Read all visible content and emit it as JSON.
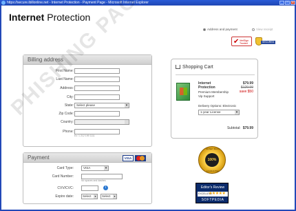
{
  "window": {
    "title": "https://secure.ibillonline.net - Internet Protection - Payment Page - Microsoft Internet Explorer",
    "buttons": [
      "_",
      "□",
      "x"
    ]
  },
  "header": {
    "title_bold": "Internet",
    "title_rest": " Protection"
  },
  "steps": {
    "step1": "Address and payment",
    "step2": "View receipt"
  },
  "trust": {
    "verisign": "VeriSign Trusted",
    "secured": "SECURED"
  },
  "billing": {
    "heading": "Billing address",
    "labels": {
      "first_name": "First Name:",
      "last_name": "Last Name:",
      "address": "Address:",
      "city": "City:",
      "state": "State:",
      "zip": "Zip Code:",
      "country": "Country:",
      "phone": "Phone:"
    },
    "state_value": "Select please",
    "phone_hint": "Ex: 1 212 199 1111"
  },
  "payment": {
    "heading": "Payment",
    "card_logos": [
      "VISA",
      "MasterCard"
    ],
    "labels": {
      "card_type": "Card Type:",
      "card_number": "Card Number:",
      "cvv": "CVV/CVC:",
      "expire": "Expire date:"
    },
    "card_type_value": "VISA",
    "card_number_hint": "No spaces and dashes",
    "expire_month": "Select",
    "expire_year": "Select"
  },
  "cart": {
    "heading": "Shopping Cart",
    "product_name": "Internet Protection",
    "product_sub1": "Premium Membership",
    "product_sub2": "Vip Support",
    "price_now": "$79.99",
    "price_old": "$129.99",
    "price_save": "save $50",
    "delivery": "Delivery Options: Electronic",
    "license": "1-year License",
    "subtotal_label": "Subtotal:",
    "subtotal_value": "$79.99"
  },
  "seal": {
    "ring_top": "MONEY BACK",
    "center": "100%",
    "ring_bottom": "GUARANTEE"
  },
  "review": {
    "title": "Editor's Review",
    "rating": "EXCELLENT",
    "stars": "★★★★★",
    "brand": "SOFTPEDIA"
  },
  "watermark": "PHISHING PAGE",
  "colors": {
    "titlebar": "#1f46b4",
    "accent_red": "#cc0000",
    "seal_gold": "#ffd24a"
  }
}
